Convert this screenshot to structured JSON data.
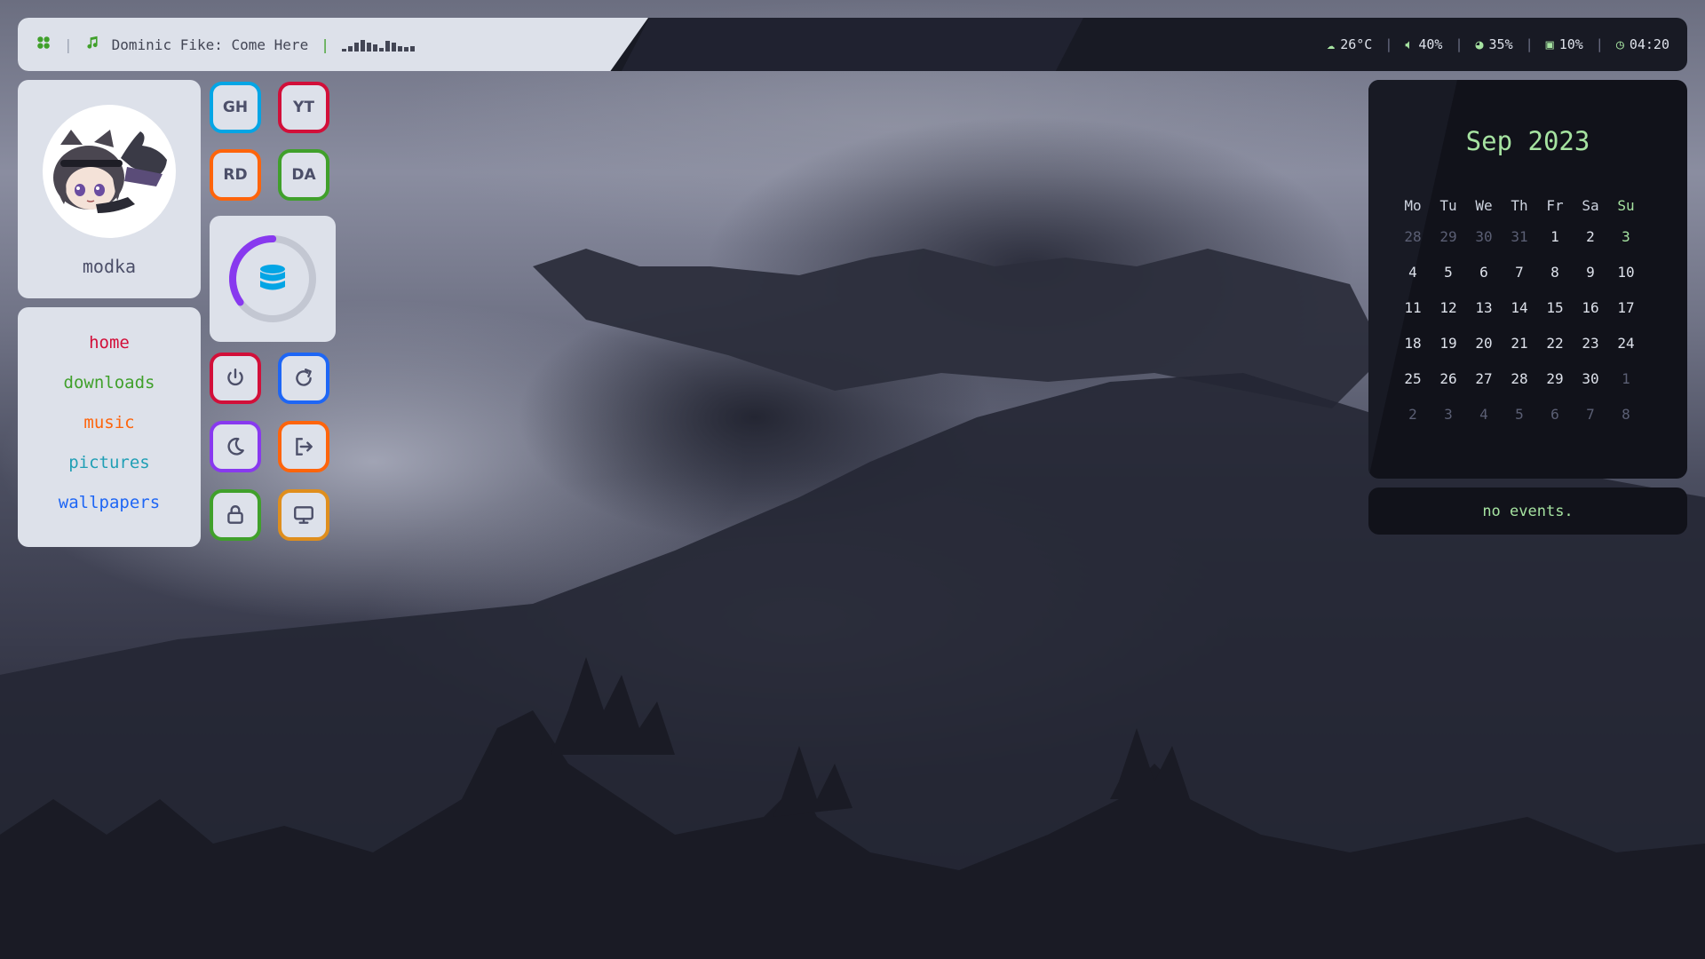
{
  "topbar": {
    "logo_icon": "flower-icon",
    "music_icon": "music-note-icon",
    "now_playing": "Dominic Fike: Come Here",
    "visualizer": [
      0.2,
      0.35,
      0.6,
      0.8,
      0.65,
      0.5,
      0.25,
      0.75,
      0.6,
      0.4,
      0.3,
      0.35
    ],
    "weather": "26°C",
    "volume": "40%",
    "disk": "35%",
    "cpu": "10%",
    "time": "04:20"
  },
  "profile": {
    "username": "modka",
    "avatar_icon": "cat-girl-avatar"
  },
  "nav": {
    "items": [
      {
        "label": "home",
        "color": "#d20f39"
      },
      {
        "label": "downloads",
        "color": "#40a02b"
      },
      {
        "label": "music",
        "color": "#fe640b"
      },
      {
        "label": "pictures",
        "color": "#209fb5"
      },
      {
        "label": "wallpapers",
        "color": "#1e66f5"
      }
    ]
  },
  "shortcuts": [
    {
      "label": "GH",
      "color": "#04a5e5"
    },
    {
      "label": "YT",
      "color": "#d20f39"
    },
    {
      "label": "RD",
      "color": "#fe640b"
    },
    {
      "label": "DA",
      "color": "#40a02b"
    }
  ],
  "disk_usage": {
    "fraction": 0.35,
    "color": "#8839ef",
    "icon": "database-icon"
  },
  "power": [
    {
      "name": "power-button",
      "icon": "power-icon",
      "color": "#d20f39"
    },
    {
      "name": "reboot-button",
      "icon": "refresh-icon",
      "color": "#1e66f5"
    },
    {
      "name": "suspend-button",
      "icon": "moon-icon",
      "color": "#8839ef"
    },
    {
      "name": "logout-button",
      "icon": "logout-icon",
      "color": "#fe640b"
    },
    {
      "name": "lock-button",
      "icon": "lock-icon",
      "color": "#40a02b"
    },
    {
      "name": "monitor-button",
      "icon": "monitor-icon",
      "color": "#df8e1d"
    }
  ],
  "calendar": {
    "title": "Sep 2023",
    "weekdays": [
      "Mo",
      "Tu",
      "We",
      "Th",
      "Fr",
      "Sa",
      "Su"
    ],
    "weeks": [
      [
        "28",
        "29",
        "30",
        "31",
        "1",
        "2",
        "3"
      ],
      [
        "4",
        "5",
        "6",
        "7",
        "8",
        "9",
        "10"
      ],
      [
        "11",
        "12",
        "13",
        "14",
        "15",
        "16",
        "17"
      ],
      [
        "18",
        "19",
        "20",
        "21",
        "22",
        "23",
        "24"
      ],
      [
        "25",
        "26",
        "27",
        "28",
        "29",
        "30",
        "1"
      ],
      [
        "2",
        "3",
        "4",
        "5",
        "6",
        "7",
        "8"
      ]
    ],
    "dim": [
      [
        true,
        true,
        true,
        true,
        false,
        false,
        false
      ],
      [
        false,
        false,
        false,
        false,
        false,
        false,
        false
      ],
      [
        false,
        false,
        false,
        false,
        false,
        false,
        false
      ],
      [
        false,
        false,
        false,
        false,
        false,
        false,
        false
      ],
      [
        false,
        false,
        false,
        false,
        false,
        false,
        true
      ],
      [
        true,
        true,
        true,
        true,
        true,
        true,
        true
      ]
    ]
  },
  "events": {
    "text": "no events."
  }
}
